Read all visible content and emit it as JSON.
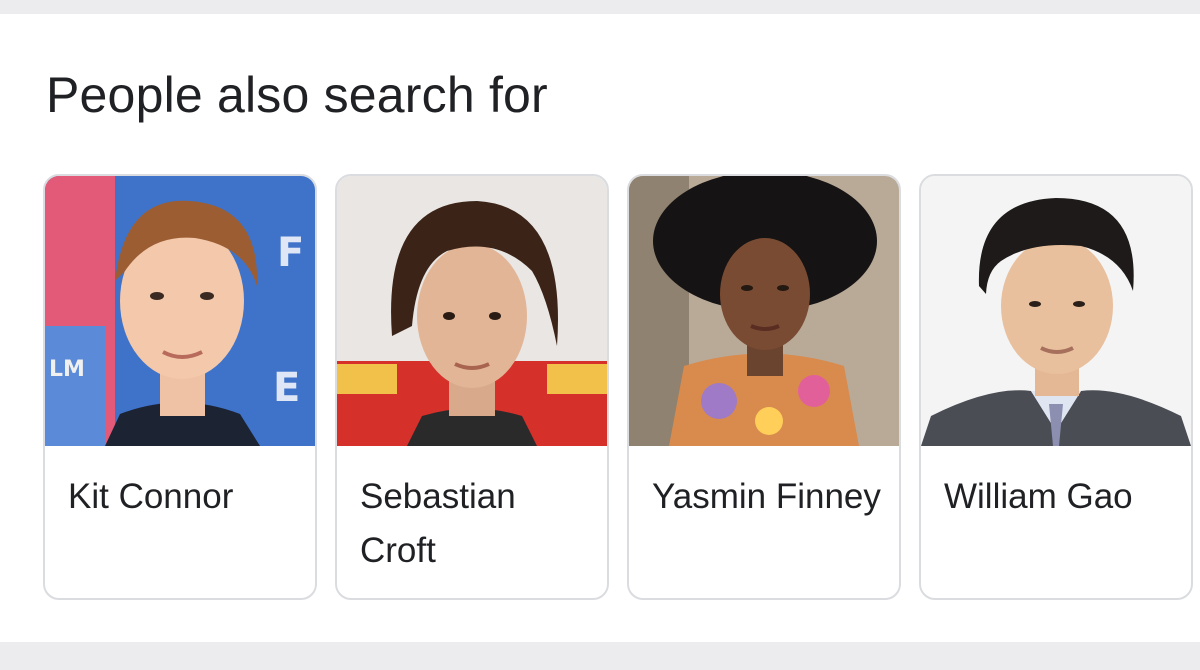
{
  "section": {
    "title": "People also search for"
  },
  "people": [
    {
      "name": "Kit Connor",
      "photo": "person-photo",
      "bg": "#3f73c9"
    },
    {
      "name": "Sebastian Croft",
      "photo": "person-photo",
      "bg": "#e9e6e4"
    },
    {
      "name": "Yasmin Finney",
      "photo": "person-photo",
      "bg": "#b9aa98"
    },
    {
      "name": "William Gao",
      "photo": "person-photo",
      "bg": "#f4f4f4"
    }
  ]
}
